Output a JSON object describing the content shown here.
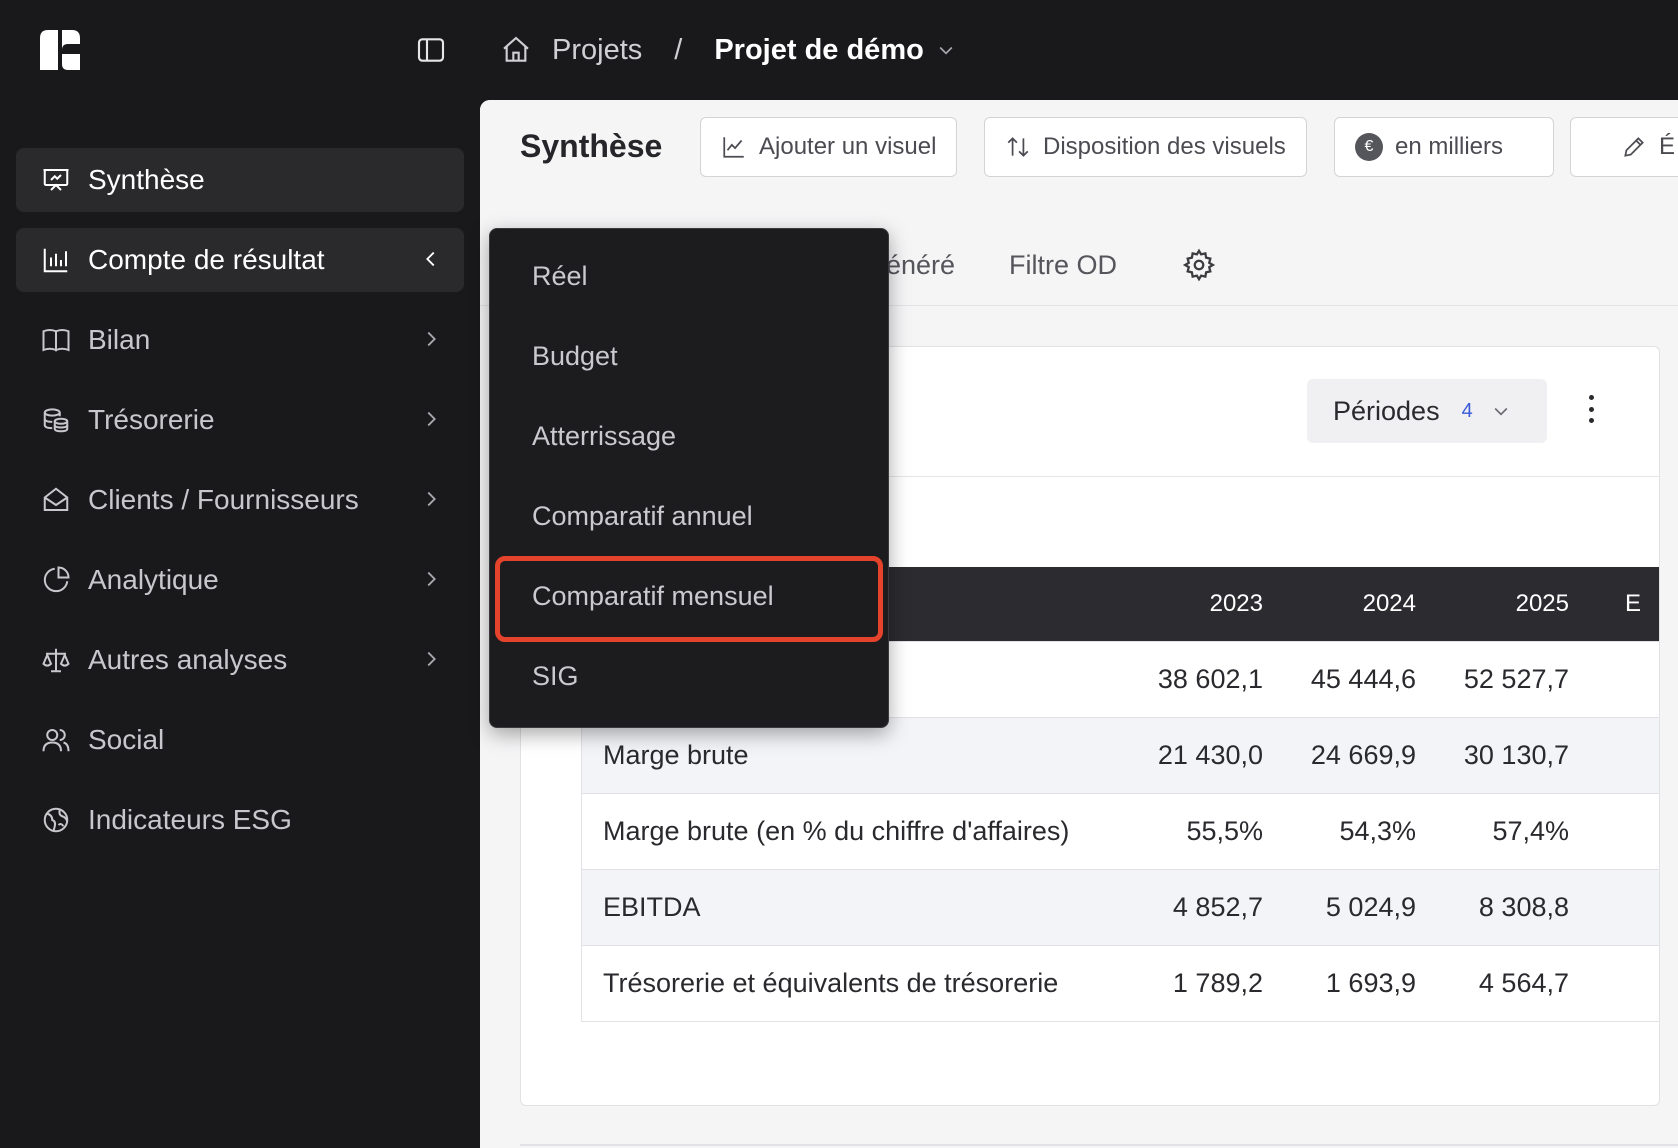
{
  "topbar": {
    "breadcrumb": {
      "projects": "Projets",
      "separator": "/",
      "current": "Projet de démo"
    }
  },
  "sidebar": {
    "items": [
      {
        "label": "Synthèse",
        "icon": "presentation-icon"
      },
      {
        "label": "Compte de résultat",
        "icon": "bar-chart-icon"
      },
      {
        "label": "Bilan",
        "icon": "book-icon"
      },
      {
        "label": "Trésorerie",
        "icon": "coins-icon"
      },
      {
        "label": "Clients / Fournisseurs",
        "icon": "mail-open-icon"
      },
      {
        "label": "Analytique",
        "icon": "pie-chart-icon"
      },
      {
        "label": "Autres analyses",
        "icon": "scale-icon"
      },
      {
        "label": "Social",
        "icon": "users-icon"
      },
      {
        "label": "Indicateurs ESG",
        "icon": "globe-icon"
      }
    ]
  },
  "main": {
    "title": "Synthèse",
    "toolbar": {
      "add_visual": "Ajouter un visuel",
      "layout": "Disposition des visuels",
      "units_badge": "€",
      "units": "en milliers",
      "edit_partial": "É"
    },
    "tabs": {
      "generated_partial": "énéré",
      "filter_od": "Filtre OD"
    },
    "card": {
      "periods_label": "Périodes",
      "periods_count": "4"
    },
    "table": {
      "headers": [
        "2023",
        "2024",
        "2025",
        "E"
      ],
      "rows": [
        {
          "label": "",
          "values": [
            "38 602,1",
            "45 444,6",
            "52 527,7"
          ]
        },
        {
          "label": "Marge brute",
          "values": [
            "21 430,0",
            "24 669,9",
            "30 130,7"
          ]
        },
        {
          "label": "Marge brute (en % du chiffre d'affaires)",
          "values": [
            "55,5%",
            "54,3%",
            "57,4%"
          ]
        },
        {
          "label": "EBITDA",
          "values": [
            "4 852,7",
            "5 024,9",
            "8 308,8"
          ]
        },
        {
          "label": "Trésorerie et équivalents de trésorerie",
          "values": [
            "1 789,2",
            "1 693,9",
            "4 564,7"
          ]
        }
      ]
    }
  },
  "dropdown": {
    "items": [
      "Réel",
      "Budget",
      "Atterrissage",
      "Comparatif annuel",
      "Comparatif mensuel",
      "SIG"
    ],
    "highlighted": "Comparatif mensuel"
  },
  "colors": {
    "sidebar_bg": "#19191b",
    "main_bg": "#f5f5f6",
    "table_header_bg": "#2c2c30",
    "highlight": "#e5432b",
    "accent_count": "#3b5bdb"
  }
}
